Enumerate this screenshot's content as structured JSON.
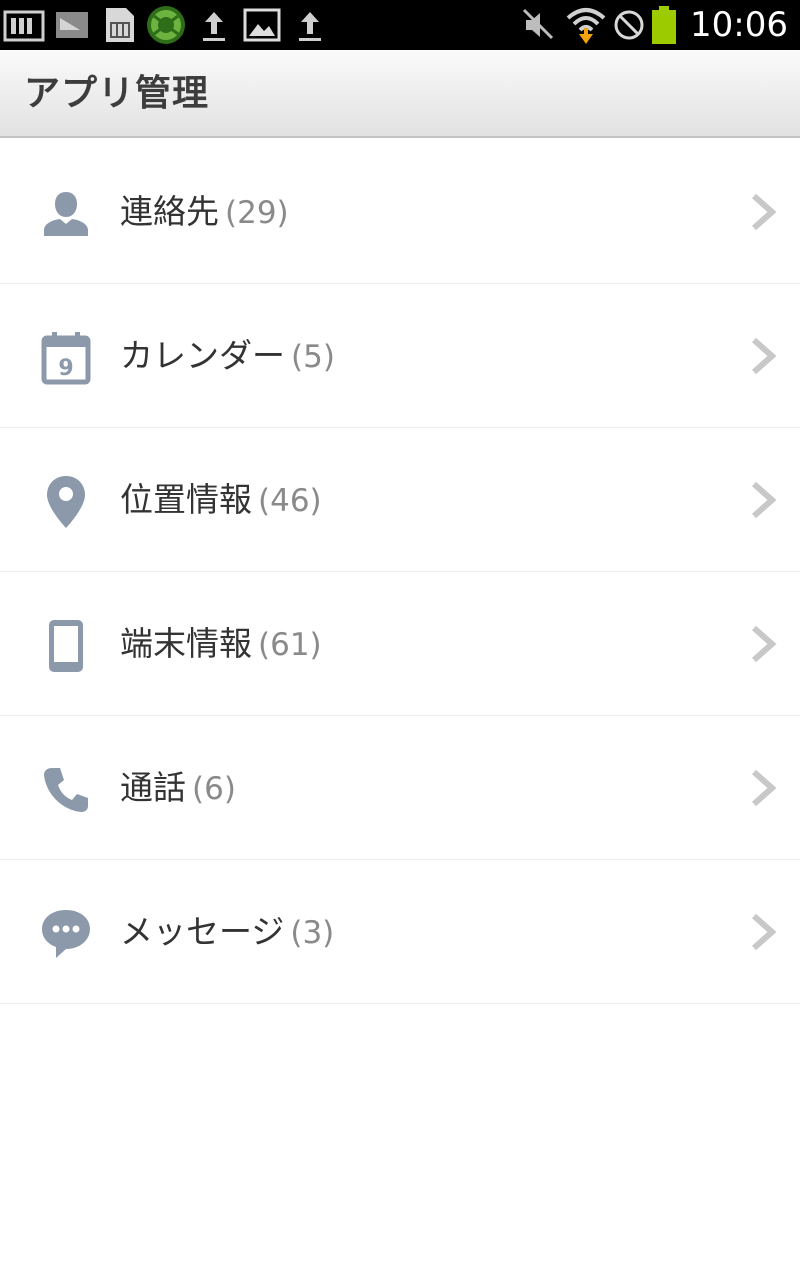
{
  "status_bar": {
    "time": "10:06",
    "icons": [
      "data-usage-icon",
      "sd-card-icon",
      "sim-card-icon",
      "security-shield-icon",
      "upload-icon",
      "gallery-icon",
      "upload-icon",
      "mute-icon",
      "wifi-icon",
      "blocked-icon",
      "battery-icon"
    ],
    "battery_color": "#9ccc00"
  },
  "action_bar": {
    "title": "アプリ管理"
  },
  "list": {
    "items": [
      {
        "label": "連絡先",
        "count": "(29)",
        "icon": "contact-person-icon"
      },
      {
        "label": "カレンダー",
        "count": "(5)",
        "icon": "calendar-icon"
      },
      {
        "label": "位置情報",
        "count": "(46)",
        "icon": "location-pin-icon"
      },
      {
        "label": "端末情報",
        "count": "(61)",
        "icon": "device-phone-icon"
      },
      {
        "label": "通話",
        "count": "(6)",
        "icon": "call-handset-icon"
      },
      {
        "label": "メッセージ",
        "count": "(3)",
        "icon": "message-bubble-icon"
      }
    ]
  },
  "colors": {
    "icon": "#8b99ab",
    "label": "#333333",
    "count": "#8a8a8a",
    "chevron": "#c8c8c8"
  }
}
